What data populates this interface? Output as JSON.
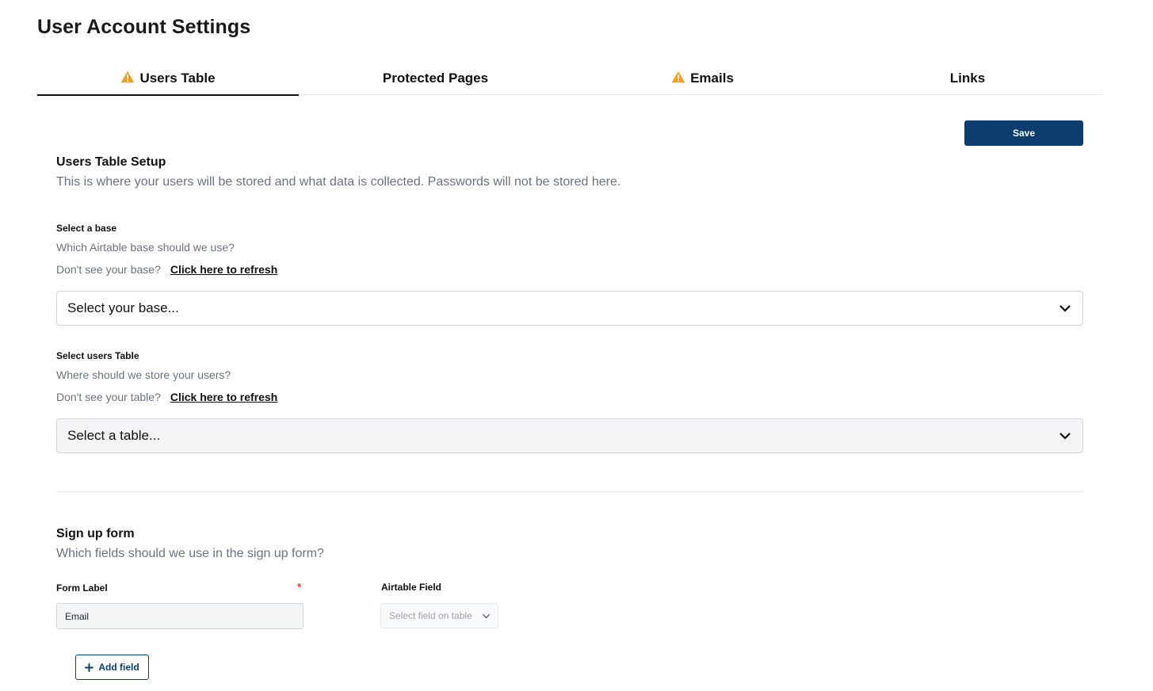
{
  "page": {
    "title": "User Account Settings"
  },
  "tabs": [
    {
      "label": "Users Table",
      "warning": true,
      "active": true
    },
    {
      "label": "Protected Pages",
      "warning": false,
      "active": false
    },
    {
      "label": "Emails",
      "warning": true,
      "active": false
    },
    {
      "label": "Links",
      "warning": false,
      "active": false
    }
  ],
  "toolbar": {
    "save_label": "Save"
  },
  "colors": {
    "accent": "#0b3d6e",
    "warning": "#f0a020",
    "required": "#e53935"
  },
  "setup": {
    "title": "Users Table Setup",
    "description": "This is where your users will be stored and what data is collected. Passwords will not be stored here.",
    "base": {
      "label": "Select a base",
      "help": "Which Airtable base should we use?",
      "refresh_prompt": "Don't see your base?",
      "refresh_link": "Click here to refresh",
      "select_value": "Select your base..."
    },
    "table": {
      "label": "Select users Table",
      "help": "Where should we store your users?",
      "refresh_prompt": "Don't see your table?",
      "refresh_link": "Click here to refresh",
      "select_value": "Select a table..."
    }
  },
  "signup": {
    "title": "Sign up form",
    "description": "Which fields should we use in the sign up form?",
    "form_label_header": "Form Label",
    "required_mark": "*",
    "airtable_field_header": "Airtable Field",
    "fields": [
      {
        "label_value": "Email",
        "airtable_placeholder": "Select field on table"
      }
    ],
    "add_field_label": "Add field"
  },
  "icons": {
    "tab_warning": "warning-triangle-icon",
    "select": "chevron-down-icon",
    "add": "plus-icon"
  }
}
